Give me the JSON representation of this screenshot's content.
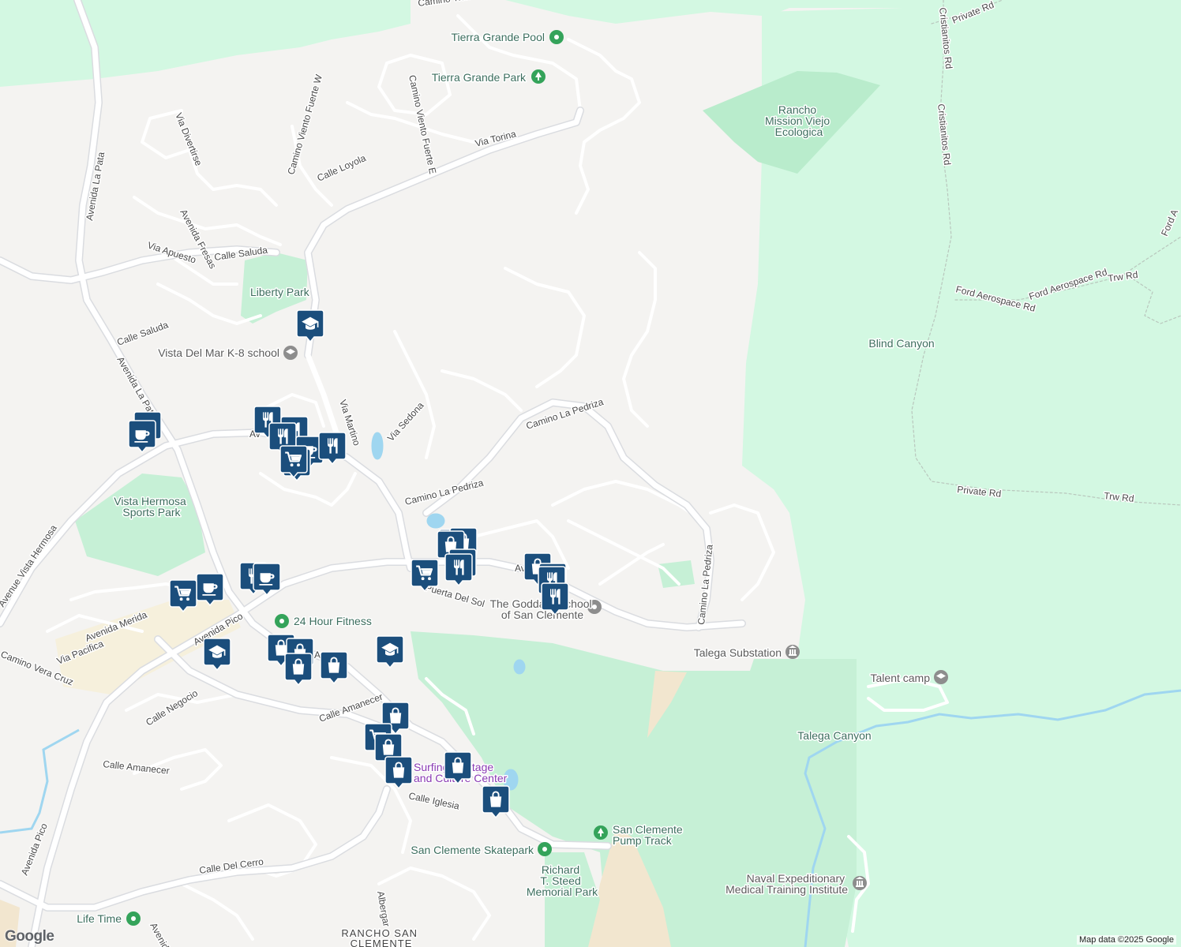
{
  "colors": {
    "park": "#c6f0d6",
    "open_space": "#d3f8e2",
    "commercial": "#f6f0dc",
    "water": "#9fd6f0",
    "road": "#ffffff",
    "road_major": "#e2e4e8",
    "marker": "#1b4e7c",
    "poi_green": "#34a35a",
    "poi_gray": "#7d7d7d"
  },
  "road_labels": [
    {
      "id": "camino-tierra-grande",
      "text": "Camino Tierra Grande"
    },
    {
      "id": "via-divertirse",
      "text": "Via Divertirse"
    },
    {
      "id": "camino-viento-fuerte-w",
      "text": "Camino Viento Fuerte W"
    },
    {
      "id": "camino-viento-fuerte-e",
      "text": "Camino Viento Fuerte E"
    },
    {
      "id": "via-torina",
      "text": "Via Torina"
    },
    {
      "id": "calle-loyola",
      "text": "Calle Loyola"
    },
    {
      "id": "avenida-la-pata-n",
      "text": "Avenida La Pata"
    },
    {
      "id": "avenida-fresas",
      "text": "Avenida Fresas"
    },
    {
      "id": "via-apuesto",
      "text": "Via Apuesto"
    },
    {
      "id": "calle-saluda-1",
      "text": "Calle Saluda"
    },
    {
      "id": "calle-saluda-2",
      "text": "Calle Saluda"
    },
    {
      "id": "avenida-la-pata-s",
      "text": "Avenida La Pata"
    },
    {
      "id": "via-martino",
      "text": "Via Martino"
    },
    {
      "id": "via-sedona",
      "text": "Via Sedona"
    },
    {
      "id": "camino-la-pedriza-1",
      "text": "Camino La Pedriza"
    },
    {
      "id": "camino-la-pedriza-2",
      "text": "Camino La Pedriza"
    },
    {
      "id": "camino-la-pedriza-3",
      "text": "Camino La Pedriza"
    },
    {
      "id": "avenue-vista-hermosa",
      "text": "Avenue Vista Hermosa"
    },
    {
      "id": "avenida-merida",
      "text": "Avenida Merida"
    },
    {
      "id": "via-pacifica",
      "text": "Via Pacifica"
    },
    {
      "id": "camino-vera-cruz",
      "text": "Camino Vera Cruz"
    },
    {
      "id": "avenida-pico-1",
      "text": "Avenida Pico"
    },
    {
      "id": "calle-negocio",
      "text": "Calle Negocio"
    },
    {
      "id": "calle-amanecer-1",
      "text": "Calle Amanecer"
    },
    {
      "id": "calle-amanecer-2",
      "text": "Calle Amanecer"
    },
    {
      "id": "puerta-del-sol",
      "text": "Puerta Del Sol"
    },
    {
      "id": "calle-iglesia",
      "text": "Calle Iglesia"
    },
    {
      "id": "calle-del-cerro",
      "text": "Calle Del Cerro"
    },
    {
      "id": "avenida-pico-2",
      "text": "Avenida Pico"
    },
    {
      "id": "albergar",
      "text": "Albergar"
    },
    {
      "id": "avenida-s",
      "text": "Avenida"
    },
    {
      "id": "private-rd-1",
      "text": "Private Rd"
    },
    {
      "id": "cristianitos-rd-1",
      "text": "Cristianitos Rd"
    },
    {
      "id": "cristianitos-rd-2",
      "text": "Cristianitos Rd"
    },
    {
      "id": "ford-aerospace-rd-1",
      "text": "Ford Aerospace Rd"
    },
    {
      "id": "ford-aerospace-rd-2",
      "text": "Ford Aerospace Rd"
    },
    {
      "id": "trw-rd-1",
      "text": "Trw Rd"
    },
    {
      "id": "trw-rd-2",
      "text": "Trw Rd"
    },
    {
      "id": "private-rd-2",
      "text": "Private Rd"
    },
    {
      "id": "ford-a",
      "text": "Ford A"
    },
    {
      "id": "avenida-frag",
      "text": "Av"
    },
    {
      "id": "avenida-frag-2",
      "text": "Av"
    },
    {
      "id": "avenida-frag-3",
      "text": "Av"
    }
  ],
  "pois": [
    {
      "id": "tierra-grande-pool",
      "text": "Tierra Grande Pool",
      "icon": "pin-circle-icon",
      "style": "green"
    },
    {
      "id": "tierra-grande-park",
      "text": "Tierra Grande Park",
      "icon": "tree-icon",
      "style": "green"
    },
    {
      "id": "rancho-mission-viejo",
      "lines": [
        "Rancho",
        "Mission Viejo",
        "Ecologica"
      ],
      "style": "green"
    },
    {
      "id": "liberty-park",
      "text": "Liberty Park",
      "style": "green"
    },
    {
      "id": "vista-del-mar",
      "text": "Vista Del Mar K-8 school",
      "icon": "school-icon",
      "style": "gray"
    },
    {
      "id": "blind-canyon",
      "text": "Blind Canyon",
      "style": "green"
    },
    {
      "id": "vista-hermosa-sports-park",
      "lines": [
        "Vista Hermosa",
        "Sports Park"
      ],
      "style": "green"
    },
    {
      "id": "24-hour-fitness",
      "text": "24 Hour Fitness",
      "icon": "pin-circle-icon",
      "style": "green"
    },
    {
      "id": "goddard-school",
      "lines": [
        "The Goddard School",
        "of San Clemente"
      ],
      "icon": "school-icon",
      "style": "gray"
    },
    {
      "id": "talega-substation",
      "text": "Talega Substation",
      "icon": "landmark-icon",
      "style": "gray"
    },
    {
      "id": "talent-camp",
      "text": "Talent camp",
      "icon": "school-icon",
      "style": "gray"
    },
    {
      "id": "talega-canyon",
      "text": "Talega Canyon",
      "style": "green"
    },
    {
      "id": "surfing-heritage",
      "lines": [
        "Surfing Heritage",
        "and Culture Center"
      ],
      "style": "purple"
    },
    {
      "id": "pump-track",
      "lines": [
        "San Clemente",
        "Pump Track"
      ],
      "icon": "tree-icon",
      "style": "green"
    },
    {
      "id": "skatepark",
      "text": "San Clemente Skatepark",
      "icon": "pin-circle-icon",
      "style": "green"
    },
    {
      "id": "steed-park",
      "lines": [
        "Richard",
        "T. Steed",
        "Memorial Park"
      ],
      "style": "green"
    },
    {
      "id": "naval-medical",
      "lines": [
        "Naval Expeditionary",
        "Medical Training Institute"
      ],
      "icon": "landmark-icon",
      "style": "gray"
    },
    {
      "id": "life-time",
      "text": "Life Time",
      "icon": "pin-circle-icon",
      "style": "green"
    },
    {
      "id": "rancho-san-clemente",
      "lines": [
        "RANCHO SAN",
        "CLEMENTE"
      ],
      "style": "dark"
    }
  ],
  "markers": [
    {
      "icon": "coffee-icon"
    },
    {
      "icon": "coffee-icon"
    },
    {
      "icon": "school-icon"
    },
    {
      "icon": "restaurant-icon"
    },
    {
      "icon": "restaurant-icon"
    },
    {
      "icon": "restaurant-icon"
    },
    {
      "icon": "coffee-icon"
    },
    {
      "icon": "restaurant-icon"
    },
    {
      "icon": "cart-icon"
    },
    {
      "icon": "cart-icon"
    },
    {
      "icon": "shopping-bag-icon"
    },
    {
      "icon": "shopping-bag-icon"
    },
    {
      "icon": "shopping-bag-icon"
    },
    {
      "icon": "restaurant-icon"
    },
    {
      "icon": "cart-icon"
    },
    {
      "icon": "restaurant-icon"
    },
    {
      "icon": "shopping-bag-icon"
    },
    {
      "icon": "shopping-bag-icon"
    },
    {
      "icon": "restaurant-icon"
    },
    {
      "icon": "restaurant-icon"
    },
    {
      "icon": "restaurant-icon"
    },
    {
      "icon": "coffee-icon"
    },
    {
      "icon": "coffee-icon"
    },
    {
      "icon": "cart-icon"
    },
    {
      "icon": "school-icon"
    },
    {
      "icon": "shopping-bag-icon"
    },
    {
      "icon": "shopping-bag-icon"
    },
    {
      "icon": "shopping-bag-icon"
    },
    {
      "icon": "shopping-bag-icon"
    },
    {
      "icon": "school-icon"
    },
    {
      "icon": "shopping-bag-icon"
    },
    {
      "icon": "cart-icon"
    },
    {
      "icon": "shopping-bag-icon"
    },
    {
      "icon": "shopping-bag-icon"
    },
    {
      "icon": "shopping-bag-icon"
    },
    {
      "icon": "shopping-bag-icon"
    }
  ],
  "logo": "Google",
  "credit": "Map data ©2025 Google"
}
